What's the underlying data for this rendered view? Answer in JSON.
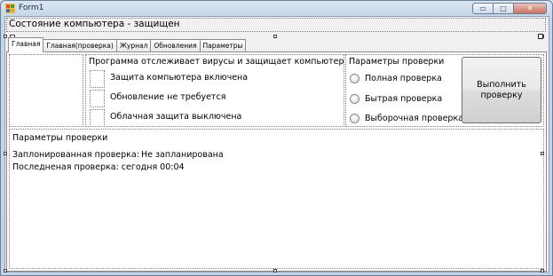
{
  "window": {
    "title": "Form1",
    "minimize_glyph": "▭",
    "maximize_glyph": "□",
    "close_glyph": "✕"
  },
  "status": {
    "text": "Состояние компьютера - защищен"
  },
  "tabs": [
    {
      "label": "Главная"
    },
    {
      "label": "Главная(проверка)"
    },
    {
      "label": "Журнал"
    },
    {
      "label": "Обновления"
    },
    {
      "label": "Параметры"
    }
  ],
  "protection": {
    "heading": "Программа отслеживает вирусы и защищает компьютер",
    "items": [
      {
        "label": "Защита компьютера включена"
      },
      {
        "label": "Обновление не требуется"
      },
      {
        "label": "Облачная защита выключена"
      }
    ]
  },
  "scan_params": {
    "heading": "Параметры проверки",
    "options": [
      {
        "label": "Полная проверка"
      },
      {
        "label": "Бытрая проверка"
      },
      {
        "label": "Выборочная проверка"
      }
    ],
    "run_button": "Выполнить проверку"
  },
  "scan_info": {
    "heading": "Параметры проверки",
    "scheduled_label": "Заплонированная проверка:",
    "scheduled_value": "Не запланирована",
    "last_scan": "Последненая проверка: сегодня 00:04"
  }
}
